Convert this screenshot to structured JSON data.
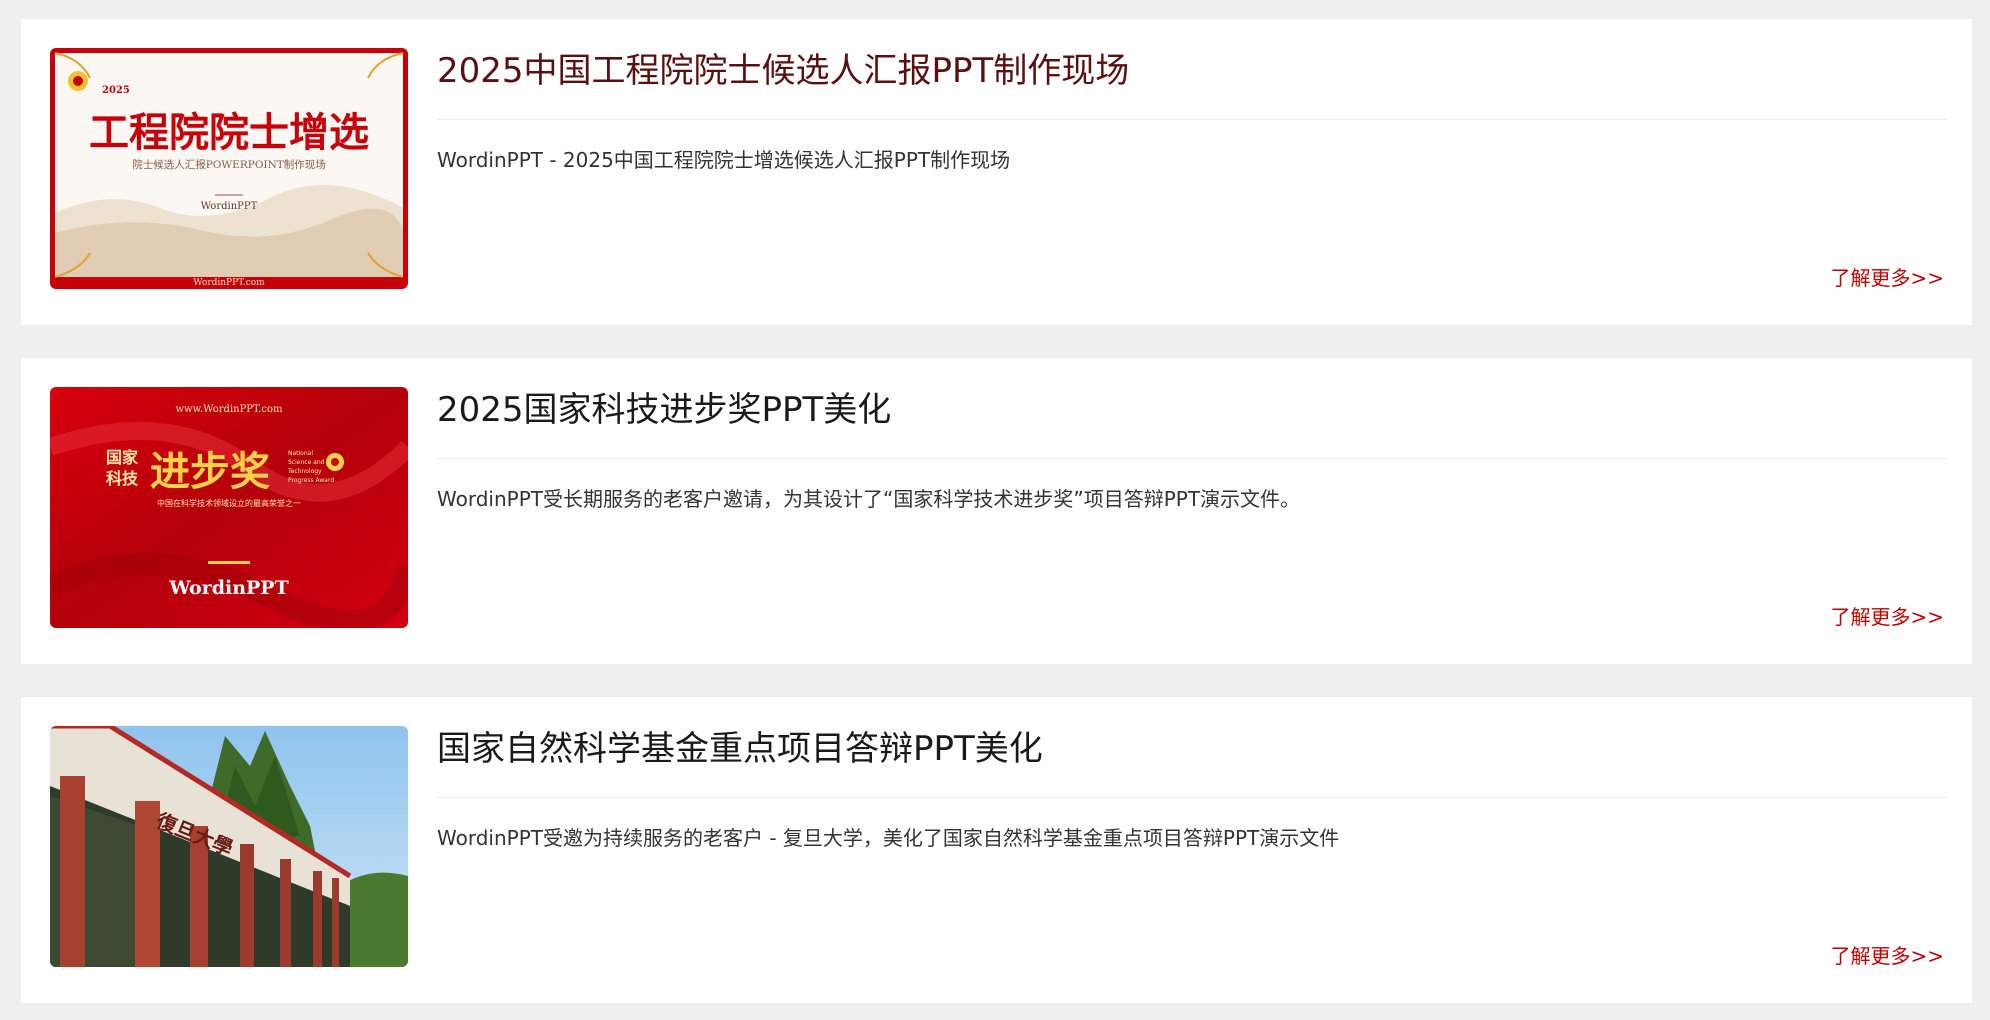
{
  "colors": {
    "page_bg": "#efefef",
    "card_bg": "#ffffff",
    "title_first": "#5a1010",
    "title": "#1a1a1a",
    "more_link": "#c00000",
    "brand_red": "#c8000a",
    "gold": "#ffd24a"
  },
  "articles": [
    {
      "title": "2025中国工程院院士候选人汇报PPT制作现场",
      "description": "WordinPPT - 2025中国工程院院士增选候选人汇报PPT制作现场",
      "more_label": "了解更多>>",
      "thumbnail": {
        "year": "2025",
        "headline": "工程院院士增选",
        "subline": "院士候选人汇报POWERPOINT制作现场",
        "brand": "WordinPPT",
        "site": "WordinPPT.com"
      }
    },
    {
      "title": "2025国家科技进步奖PPT美化",
      "description": "WordinPPT受长期服务的老客户邀请，为其设计了“国家科学技术进步奖”项目答辩PPT演示文件。",
      "more_label": "了解更多>>",
      "thumbnail": {
        "site": "www.WordinPPT.com",
        "left_line1": "国家",
        "left_line2": "科技",
        "headline": "进步奖",
        "en_line1": "National",
        "en_line2": "Science and",
        "en_line3": "Technology",
        "en_line4": "Progress Award",
        "subline": "中国在科学技术领域设立的最高荣誉之一",
        "brand": "WordinPPT"
      }
    },
    {
      "title": "国家自然科学基金重点项目答辩PPT美化",
      "description": "WordinPPT受邀为持续服务的老客户 - 复旦大学，美化了国家自然科学基金重点项目答辩PPT演示文件",
      "more_label": "了解更多>>",
      "thumbnail": {
        "gate_text": "復旦大學"
      }
    }
  ]
}
